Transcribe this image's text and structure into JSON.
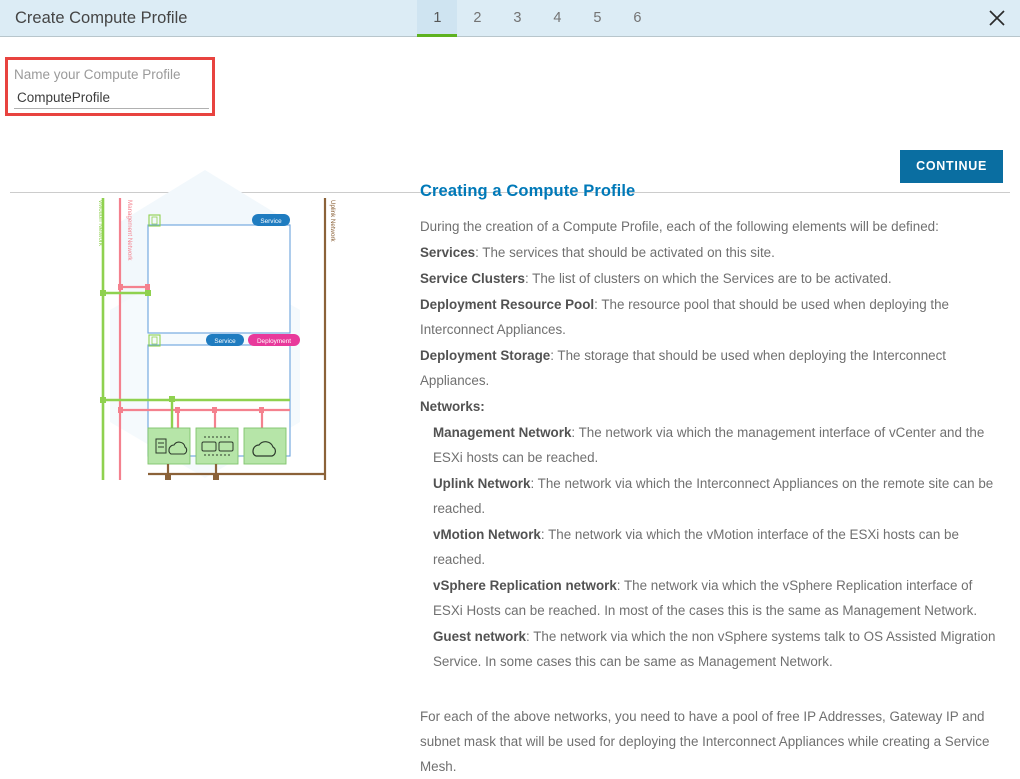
{
  "header": {
    "title": "Create Compute Profile",
    "tabs": [
      {
        "label": "1",
        "active": true
      },
      {
        "label": "2",
        "active": false
      },
      {
        "label": "3",
        "active": false
      },
      {
        "label": "4",
        "active": false
      },
      {
        "label": "5",
        "active": false
      },
      {
        "label": "6",
        "active": false
      }
    ],
    "close_icon": "close-icon",
    "background_color": "#dcecf5",
    "active_tab_accent": "#5eb220"
  },
  "form": {
    "label": "Name your Compute Profile",
    "value": "ComputeProfile",
    "placeholder": "",
    "highlight_color": "#e8433f",
    "continue_label": "CONTINUE",
    "continue_color": "#0a6ea1"
  },
  "info": {
    "heading": "Creating a Compute Profile",
    "heading_color": "#0079b8",
    "intro": "During the creation of a Compute Profile, each of the following elements will be defined:",
    "items": [
      {
        "term": "Services",
        "desc": ": The services that should be activated on this site."
      },
      {
        "term": "Service Clusters",
        "desc": ": The list of clusters on which the Services are to be activated."
      },
      {
        "term": "Deployment Resource Pool",
        "desc": ": The resource pool that should be used when deploying the Interconnect Appliances."
      },
      {
        "term": "Deployment Storage",
        "desc": ": The storage that should be used when deploying the Interconnect Appliances."
      },
      {
        "term": "Networks:",
        "desc": ""
      }
    ],
    "networks": [
      {
        "term": "Management Network",
        "desc": ": The network via which the management interface of vCenter and the ESXi hosts can be reached."
      },
      {
        "term": "Uplink Network",
        "desc": ": The network via which the Interconnect Appliances on the remote site can be reached."
      },
      {
        "term": "vMotion Network",
        "desc": ": The network via which the vMotion interface of the ESXi hosts can be reached."
      },
      {
        "term": "vSphere Replication network",
        "desc": ": The network via which the vSphere Replication interface of ESXi Hosts can be reached. In most of the cases this is the same as Management Network."
      },
      {
        "term": "Guest network",
        "desc": ": The network via which the non vSphere systems talk to OS Assisted Migration Service. In some cases this can be same as Management Network."
      }
    ],
    "footer": "For each of the above networks, you need to have a pool of free IP Addresses, Gateway IP and subnet mask that will be used for deploying the Interconnect Appliances while creating a Service Mesh."
  },
  "diagram": {
    "network_labels": [
      {
        "text": "vMotion Network",
        "color": "#8fd14f"
      },
      {
        "text": "Management Network",
        "color": "#f4818e"
      },
      {
        "text": "Uplink Network",
        "color": "#8b6239"
      }
    ],
    "badges": [
      {
        "text": "Service",
        "color": "#1f7cc0"
      },
      {
        "text": "Service",
        "color": "#1f7cc0"
      },
      {
        "text": "Deployment",
        "color": "#e8399b"
      }
    ],
    "appliance_icons": [
      "server-cloud-icon",
      "network-switch-icon",
      "cloud-icon"
    ]
  }
}
